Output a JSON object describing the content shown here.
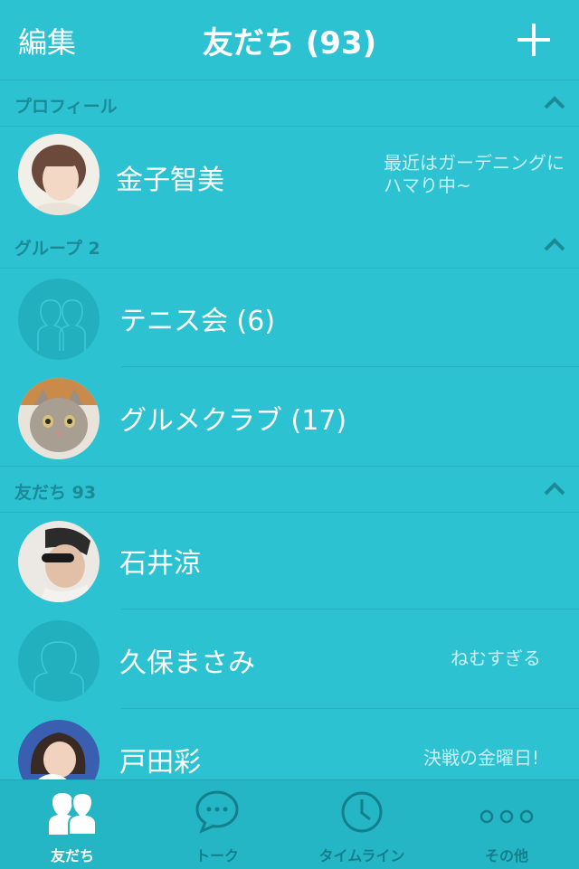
{
  "header": {
    "edit_label": "編集",
    "title": "友だち (93)"
  },
  "sections": {
    "profile": {
      "label": "プロフィール"
    },
    "groups": {
      "label": "グループ 2"
    },
    "friends": {
      "label": "友だち 93"
    }
  },
  "profile": {
    "name": "金子智美",
    "status": "最近はガーデニングに\nハマり中~"
  },
  "groups": [
    {
      "name": "テニス会 (6)"
    },
    {
      "name": "グルメクラブ (17)"
    }
  ],
  "friends": [
    {
      "name": "石井涼",
      "status": ""
    },
    {
      "name": "久保まさみ",
      "status": "ねむすぎる"
    },
    {
      "name": "戸田彩",
      "status": "決戦の金曜日!"
    }
  ],
  "tabs": [
    {
      "label": "友だち",
      "icon": "friends-icon",
      "active": true
    },
    {
      "label": "トーク",
      "icon": "chat-bubble-icon",
      "active": false
    },
    {
      "label": "タイムライン",
      "icon": "clock-icon",
      "active": false
    },
    {
      "label": "その他",
      "icon": "more-dots-icon",
      "active": false
    }
  ],
  "colors": {
    "background": "#2cc2d1",
    "section_text": "#1b8a96",
    "tab_inactive": "#137f8b"
  }
}
